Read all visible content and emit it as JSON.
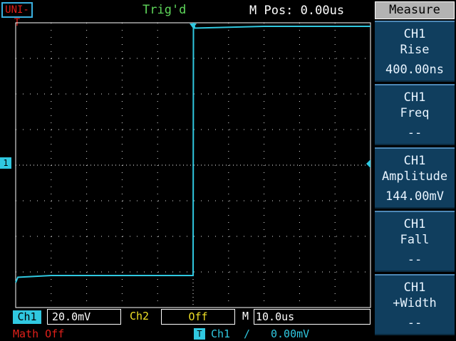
{
  "header": {
    "brand": "UNI-T",
    "trigger_status": "Trig'd",
    "m_pos": "M Pos: 0.00us"
  },
  "measure": {
    "title": "Measure",
    "items": [
      {
        "channel": "CH1",
        "name": "Rise",
        "value": "400.00ns"
      },
      {
        "channel": "CH1",
        "name": "Freq",
        "value": "--"
      },
      {
        "channel": "CH1",
        "name": "Amplitude",
        "value": "144.00mV"
      },
      {
        "channel": "CH1",
        "name": "Fall",
        "value": "--"
      },
      {
        "channel": "CH1",
        "name": "+Width",
        "value": "--"
      }
    ]
  },
  "footer": {
    "ch1_label": "Ch1",
    "ch1_volts": "20.0mV",
    "ch2_label": "Ch2",
    "ch2_value": "Off",
    "m_label": "M",
    "m_timebase": "10.0us",
    "math": "Math Off",
    "trig_tag": "T",
    "trig_channel": "Ch1",
    "trig_edge": "∕",
    "trig_level": "0.00mV"
  },
  "channel_marker": "1",
  "colors": {
    "ch1": "#30c8e0",
    "ch2": "#f0e026",
    "trig_status": "#5ed65a",
    "math": "#e0201a",
    "panel": "#103e5e"
  },
  "chart_data": {
    "type": "line",
    "series": [
      {
        "values": [
          {
            "x": -50,
            "y": -66
          },
          {
            "x": -49.4,
            "y": -63
          },
          {
            "x": -40,
            "y": -62
          },
          {
            "x": -20,
            "y": -62
          },
          {
            "x": 0,
            "y": -62
          },
          {
            "x": 0.1,
            "y": 80
          },
          {
            "x": 0.5,
            "y": 77
          },
          {
            "x": 20,
            "y": 78
          },
          {
            "x": 50,
            "y": 78
          }
        ]
      }
    ],
    "xlim": [
      -50,
      50
    ],
    "ylim": [
      -80,
      80
    ],
    "grid": true
  }
}
